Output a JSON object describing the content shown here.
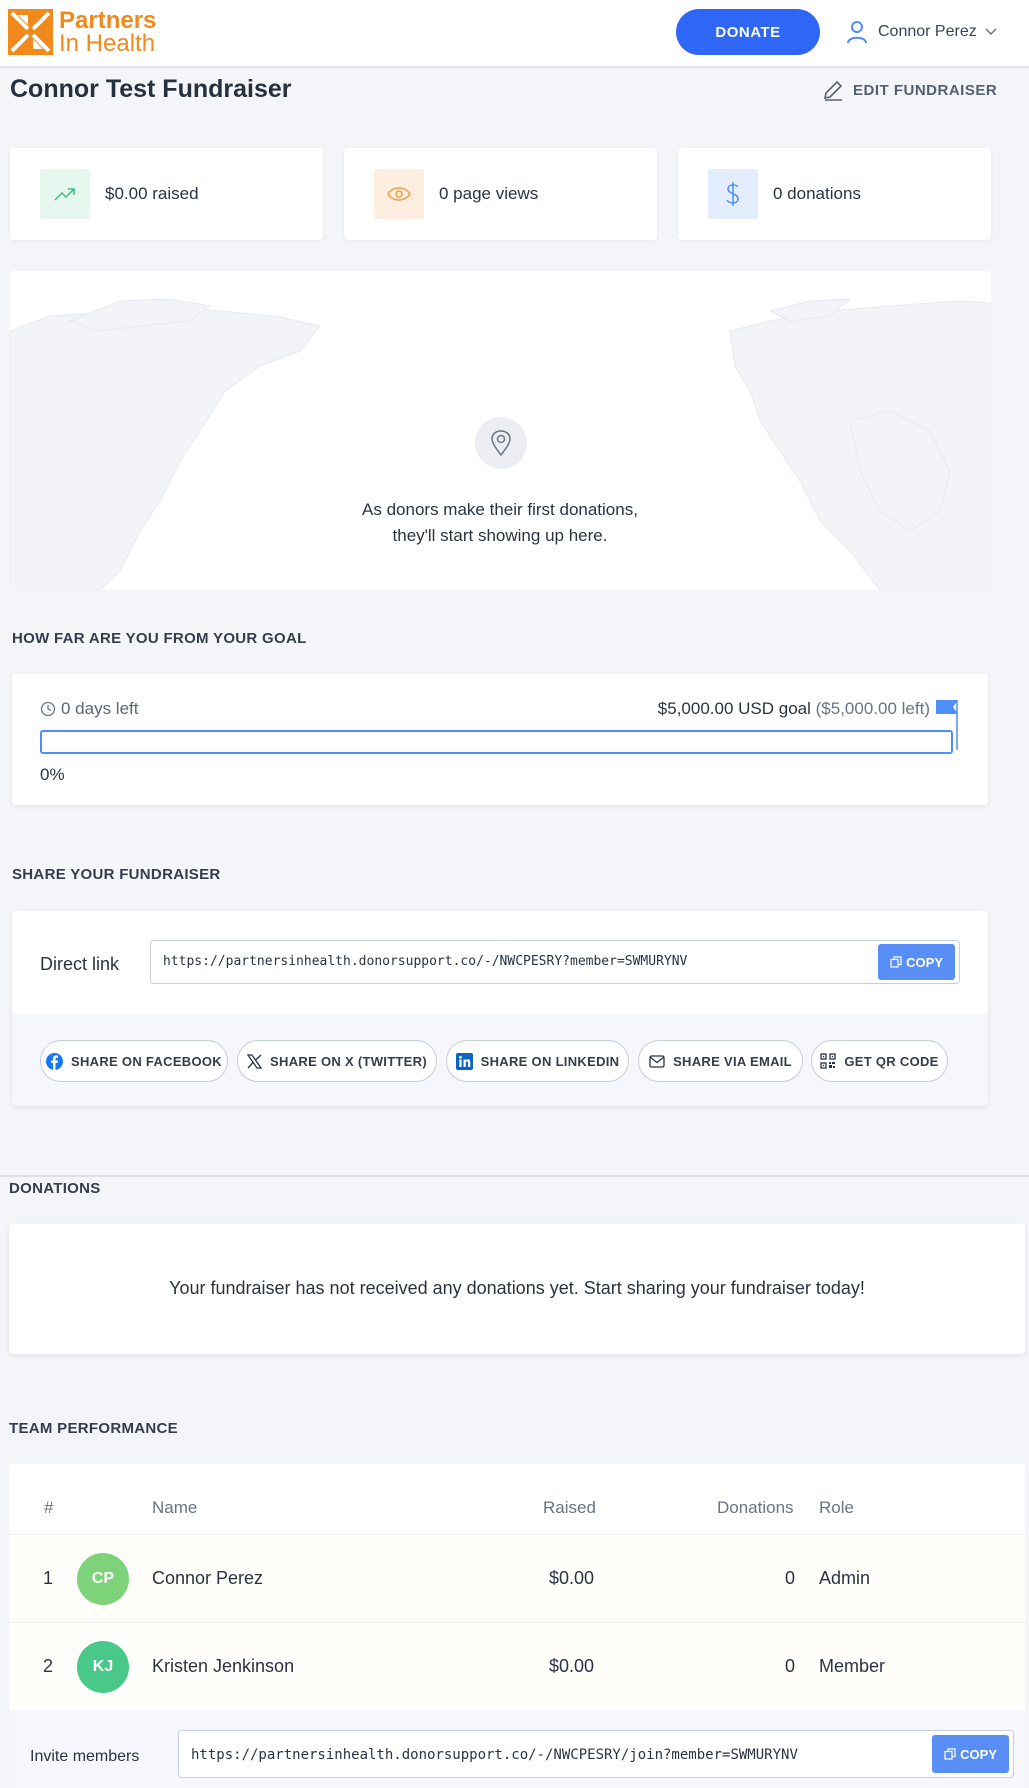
{
  "header": {
    "logo_line1": "Partners",
    "logo_line2": "In Health",
    "donate_label": "DONATE",
    "user_name": "Connor Perez"
  },
  "page": {
    "title": "Connor Test Fundraiser",
    "edit_label": "EDIT FUNDRAISER"
  },
  "stats": [
    {
      "text": "$0.00 raised",
      "icon": "trending-up-icon",
      "color": "#3cbf83",
      "bg": "#e5f7ef"
    },
    {
      "text": "0 page views",
      "icon": "eye-icon",
      "color": "#f0a04a",
      "bg": "#fdeedf"
    },
    {
      "text": "0 donations",
      "icon": "dollar-icon",
      "color": "#4d8ef7",
      "bg": "#e4edfd"
    }
  ],
  "map": {
    "message_line1": "As donors make their first donations,",
    "message_line2": "they'll start showing up here."
  },
  "goal": {
    "section_label": "HOW FAR ARE YOU FROM YOUR GOAL",
    "days_left": "0 days left",
    "goal_amount": "$5,000.00 USD goal",
    "goal_left": "($5,000.00 left)",
    "progress_fraction": 0,
    "percent_label": "0%"
  },
  "share": {
    "section_label": "SHARE YOUR FUNDRAISER",
    "direct_link_label": "Direct link",
    "direct_link_url": "https://partnersinhealth.donorsupport.co/-/NWCPESRY?member=SWMURYNV",
    "copy_label": "COPY",
    "buttons": {
      "facebook": "SHARE ON FACEBOOK",
      "twitter": "SHARE ON X (TWITTER)",
      "linkedin": "SHARE ON LINKEDIN",
      "email": "SHARE VIA EMAIL",
      "qr": "GET QR CODE"
    }
  },
  "donations": {
    "section_label": "DONATIONS",
    "empty_message": "Your fundraiser has not received any donations yet. Start sharing your fundraiser today!"
  },
  "team": {
    "section_label": "TEAM PERFORMANCE",
    "columns": {
      "index": "#",
      "name": "Name",
      "raised": "Raised",
      "donations": "Donations",
      "role": "Role"
    },
    "rows": [
      {
        "index": "1",
        "initials": "CP",
        "name": "Connor Perez",
        "raised": "$0.00",
        "donations": "0",
        "role": "Admin",
        "avatar_color": "#7ed37a"
      },
      {
        "index": "2",
        "initials": "KJ",
        "name": "Kristen Jenkinson",
        "raised": "$0.00",
        "donations": "0",
        "role": "Member",
        "avatar_color": "#48c98a"
      }
    ],
    "invite_label": "Invite members",
    "invite_url": "https://partnersinhealth.donorsupport.co/-/NWCPESRY/join?member=SWMURYNV",
    "copy_label": "COPY"
  },
  "colors": {
    "accent": "#2e66f6",
    "brand": "#f08a1c"
  }
}
